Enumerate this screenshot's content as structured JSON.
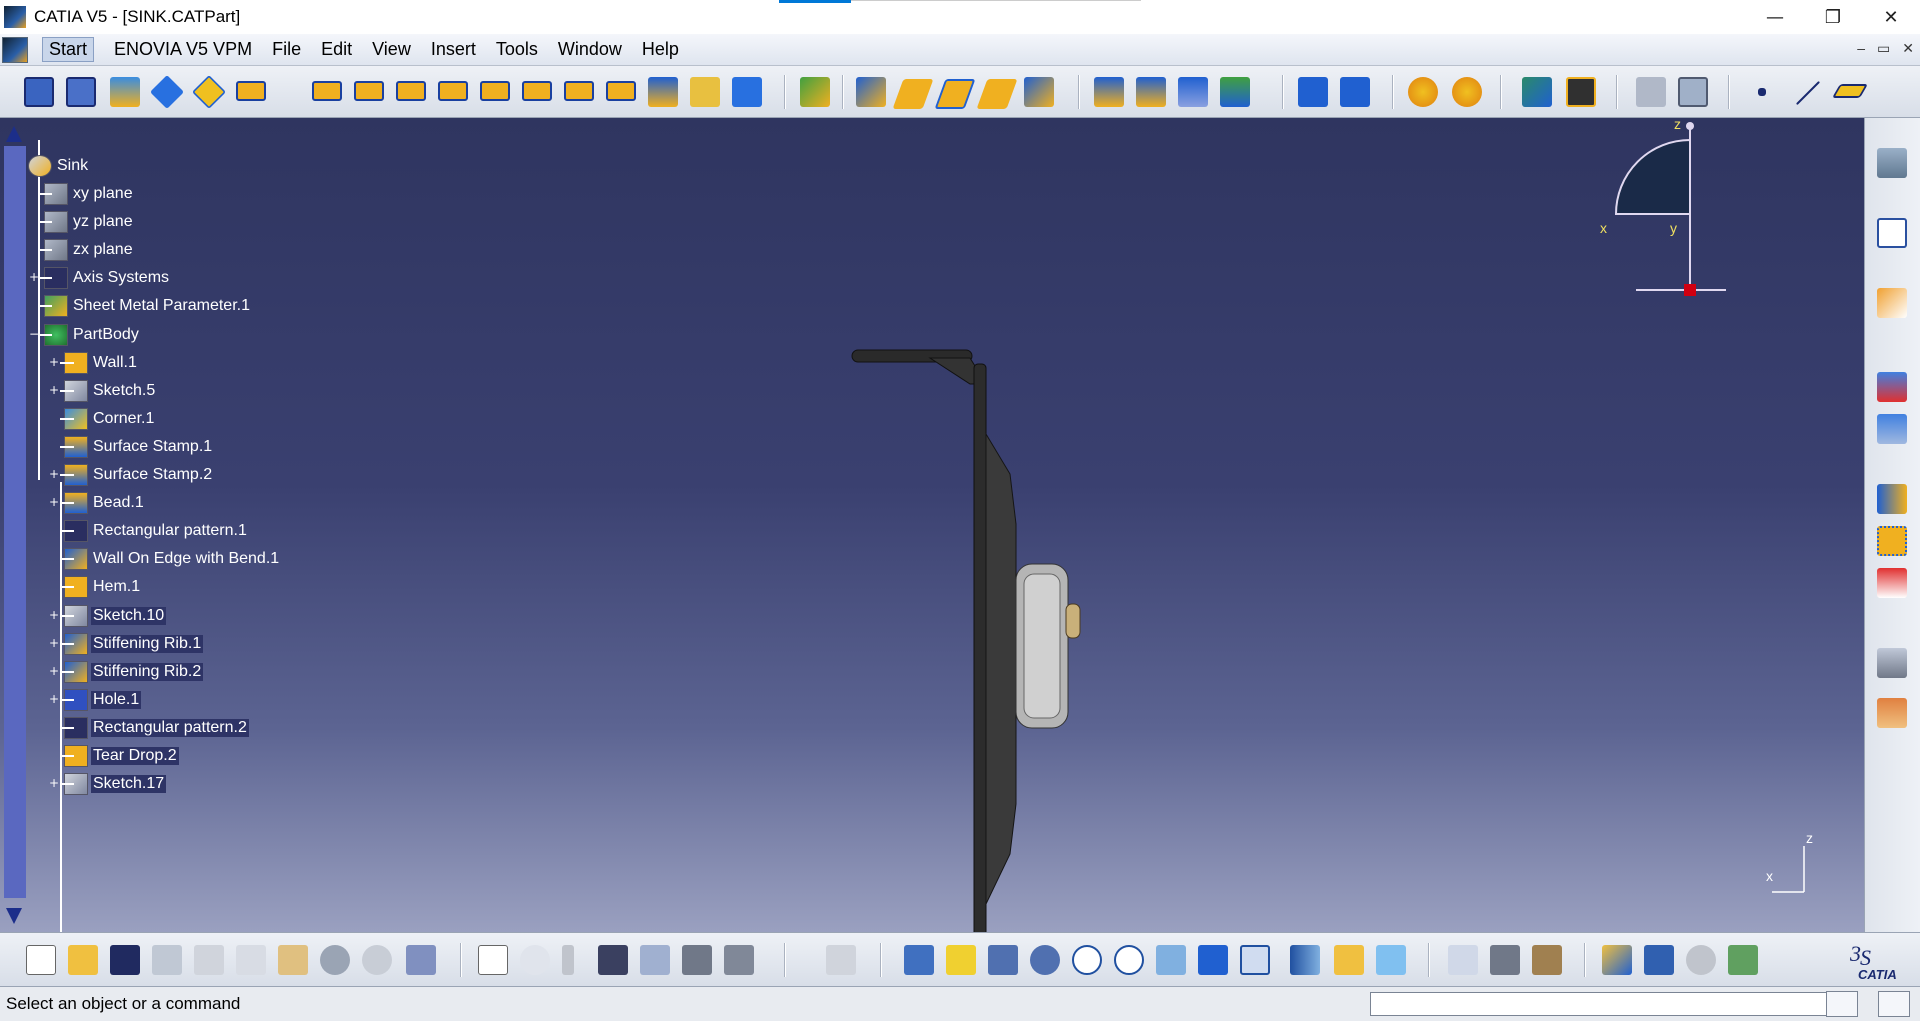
{
  "window": {
    "title": "CATIA V5 - [SINK.CATPart]",
    "minimize": "—",
    "restore": "❐",
    "close": "✕"
  },
  "menu": {
    "start": "Start",
    "items": [
      "ENOVIA V5 VPM",
      "File",
      "Edit",
      "View",
      "Insert",
      "Tools",
      "Window",
      "Help"
    ],
    "mdi_minimize": "–",
    "mdi_restore": "▭",
    "mdi_close": "✕"
  },
  "tree": {
    "root": "Sink",
    "nodes": [
      {
        "label": "xy plane",
        "icon": "plane-icon",
        "selected": false
      },
      {
        "label": "yz plane",
        "icon": "plane-icon",
        "selected": false
      },
      {
        "label": "zx plane",
        "icon": "plane-icon",
        "selected": false
      },
      {
        "label": "Axis Systems",
        "icon": "axis-systems-icon",
        "selected": false
      },
      {
        "label": "Sheet Metal Parameter.1",
        "icon": "sheet-metal-parameter-icon",
        "selected": false
      },
      {
        "label": "PartBody",
        "icon": "part-body-icon",
        "selected": false
      },
      {
        "label": "Wall.1",
        "icon": "wall-icon",
        "selected": false
      },
      {
        "label": "Sketch.5",
        "icon": "sketch-icon",
        "selected": false
      },
      {
        "label": "Corner.1",
        "icon": "corner-icon",
        "selected": false
      },
      {
        "label": "Surface Stamp.1",
        "icon": "surface-stamp-icon",
        "selected": false
      },
      {
        "label": "Surface Stamp.2",
        "icon": "surface-stamp-icon",
        "selected": false
      },
      {
        "label": "Bead.1",
        "icon": "bead-icon",
        "selected": false
      },
      {
        "label": "Rectangular pattern.1",
        "icon": "rectangular-pattern-icon",
        "selected": false
      },
      {
        "label": "Wall On Edge with Bend.1",
        "icon": "wall-on-edge-icon",
        "selected": false
      },
      {
        "label": "Hem.1",
        "icon": "hem-icon",
        "selected": false
      },
      {
        "label": "Sketch.10",
        "icon": "sketch-icon",
        "selected": true
      },
      {
        "label": "Stiffening Rib.1",
        "icon": "stiffening-rib-icon",
        "selected": true
      },
      {
        "label": "Stiffening Rib.2",
        "icon": "stiffening-rib-icon",
        "selected": true
      },
      {
        "label": "Hole.1",
        "icon": "hole-icon",
        "selected": true
      },
      {
        "label": "Rectangular pattern.2",
        "icon": "rectangular-pattern-icon",
        "selected": true
      },
      {
        "label": "Tear Drop.2",
        "icon": "tear-drop-icon",
        "selected": true
      },
      {
        "label": "Sketch.17",
        "icon": "sketch-icon",
        "selected": true
      }
    ]
  },
  "compass": {
    "z": "z",
    "x": "x",
    "y": "y"
  },
  "axis_triad": {
    "z": "z",
    "x": "x"
  },
  "status": {
    "message": "Select an object or a command",
    "command_placeholder": ""
  },
  "brand": {
    "logo_text": "CATIA"
  },
  "colors": {
    "viewport_top": "#2f3560",
    "viewport_bottom": "#9aa0c0",
    "selection": "#2e3466",
    "compass_fill": "#1a2a48"
  }
}
